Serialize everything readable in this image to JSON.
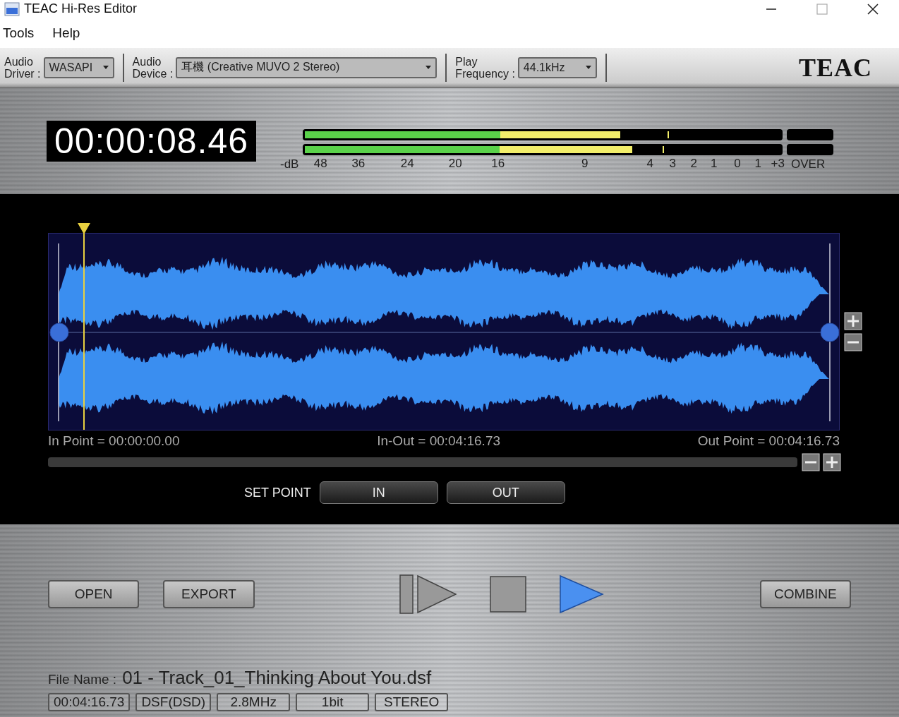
{
  "window": {
    "title": "TEAC Hi-Res Editor"
  },
  "menu": [
    {
      "label": "Tools"
    },
    {
      "label": "Help"
    }
  ],
  "toolbar": {
    "driver": {
      "label_1": "Audio",
      "label_2": "Driver :",
      "value": "WASAPI"
    },
    "device": {
      "label_1": "Audio",
      "label_2": "Device :",
      "value": "耳機 (Creative MUVO 2 Stereo)"
    },
    "frequency": {
      "label_1": "Play",
      "label_2": "Frequency :",
      "value": "44.1kHz"
    },
    "logo": "TEAC"
  },
  "time_display": "00:00:08.46",
  "meter": {
    "channels": [
      {
        "level": 0.657,
        "peak": {
          "level": 0.76
        }
      },
      {
        "level": 0.683,
        "peak": {
          "level": 0.75
        }
      }
    ],
    "unit": "-dB",
    "scale": [
      "48",
      "36",
      "24",
      "20",
      "16",
      "9",
      "4",
      "3",
      "2",
      "1",
      "0",
      "1",
      "+3"
    ],
    "over": "OVER"
  },
  "waveform": {
    "playhead": {
      "level": 0.033
    }
  },
  "points": {
    "in_point": "In Point = 00:00:00.00",
    "in_out": "In-Out = 00:04:16.73",
    "out_point": "Out Point = 00:04:16.73"
  },
  "set_point": {
    "label": "SET POINT",
    "buttons": [
      "IN",
      "OUT"
    ]
  },
  "buttons": {
    "left": [
      "OPEN",
      "EXPORT"
    ],
    "right": [
      "COMBINE"
    ]
  },
  "file": {
    "label": "File Name :",
    "name": "01 - Track_01_Thinking About You.dsf"
  },
  "info": [
    "00:04:16.73",
    "DSF(DSD)",
    "2.8MHz",
    "1bit",
    "STEREO"
  ]
}
